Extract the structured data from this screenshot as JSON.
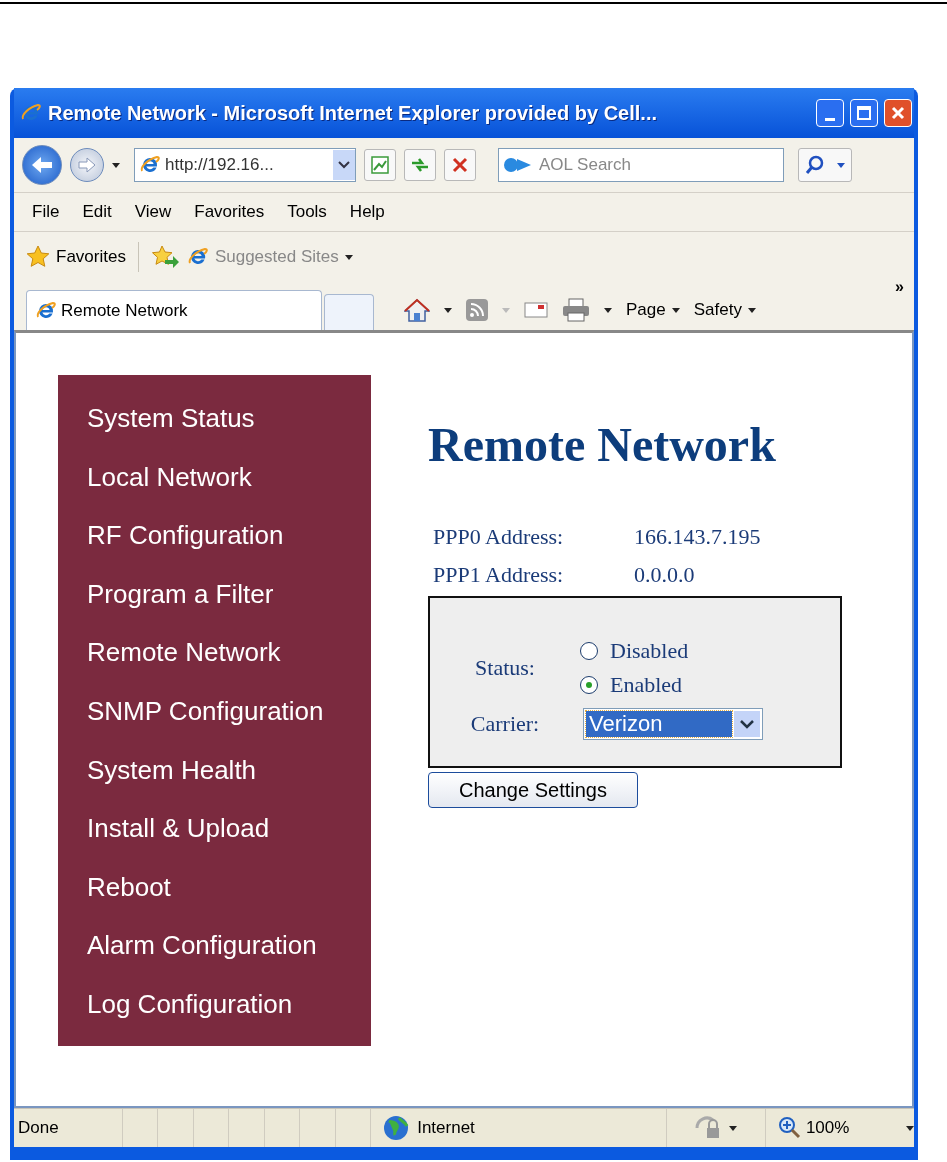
{
  "window": {
    "title": "Remote Network - Microsoft Internet Explorer provided by Cell..."
  },
  "address_bar": {
    "value": "http://192.16..."
  },
  "search": {
    "placeholder": "AOL Search"
  },
  "menu": [
    "File",
    "Edit",
    "View",
    "Favorites",
    "Tools",
    "Help"
  ],
  "favorites_bar": {
    "favorites": "Favorites",
    "suggested_sites": "Suggested Sites"
  },
  "tabs": [
    {
      "label": "Remote Network",
      "selected": true
    }
  ],
  "command_bar": {
    "items": [
      "Page",
      "Safety"
    ],
    "overflow": "»"
  },
  "sidebar": {
    "items": [
      "System Status",
      "Local Network",
      "RF Configuration",
      "Program a Filter",
      "Remote Network",
      "SNMP Configuration",
      "System Health",
      "Install & Upload",
      "Reboot",
      "Alarm Configuration",
      "Log Configuration"
    ]
  },
  "page": {
    "heading": "Remote Network",
    "addresses": [
      {
        "label": "PPP0 Address:",
        "value": "166.143.7.195"
      },
      {
        "label": "PPP1 Address:",
        "value": "0.0.0.0"
      }
    ],
    "form": {
      "status_label": "Status:",
      "status_options": [
        {
          "label": "Disabled",
          "selected": false
        },
        {
          "label": "Enabled",
          "selected": true
        }
      ],
      "carrier_label": "Carrier:",
      "carrier": "Verizon",
      "submit": "Change Settings"
    }
  },
  "status_bar": {
    "text": "Done",
    "zone": "Internet",
    "zoom": "100%"
  }
}
